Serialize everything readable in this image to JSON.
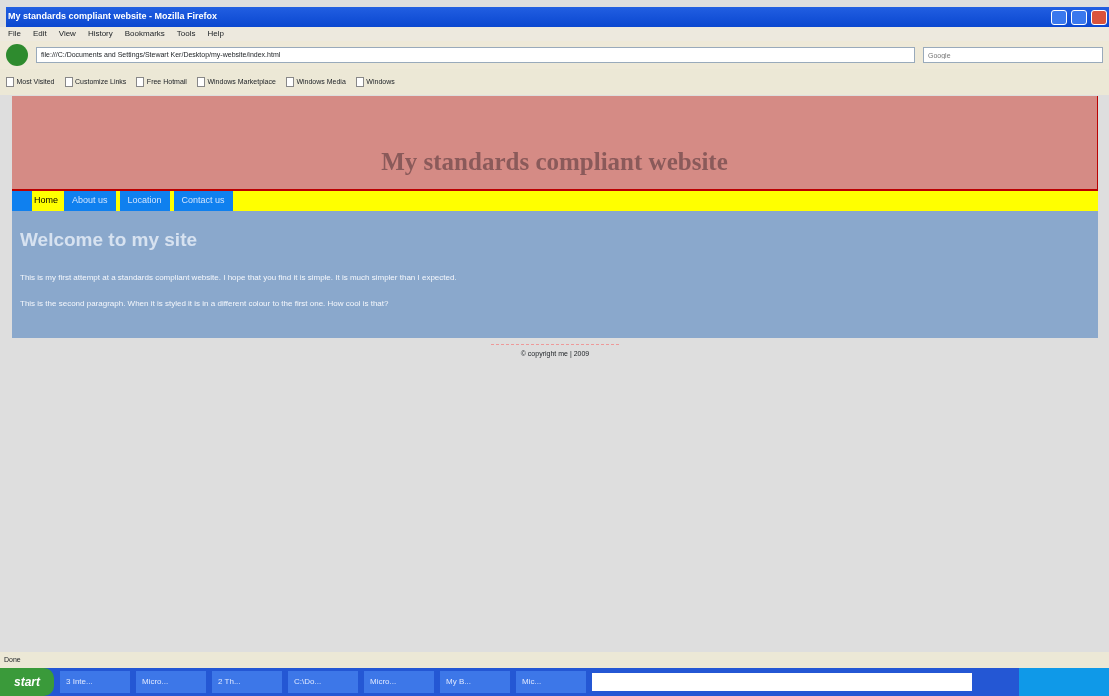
{
  "window": {
    "title": "My standards compliant website - Mozilla Firefox"
  },
  "menu": [
    "File",
    "Edit",
    "View",
    "History",
    "Bookmarks",
    "Tools",
    "Help"
  ],
  "address": {
    "value": "file:///C:/Documents and Settings/Stewart Ker/Desktop/my-website/index.html"
  },
  "search": {
    "placeholder": "Google"
  },
  "bookmarks": [
    "Most Visited",
    "Customize Links",
    "Free Hotmail",
    "Windows Marketplace",
    "Windows Media",
    "Windows"
  ],
  "site": {
    "heading": "My standards compliant website",
    "nav": [
      {
        "label": "Home",
        "selected": true
      },
      {
        "label": "About us",
        "selected": false
      },
      {
        "label": "Location",
        "selected": false
      },
      {
        "label": "Contact us",
        "selected": false
      }
    ],
    "title": "Welcome to my site",
    "paragraphs": [
      "This is my first attempt at a standards compliant website. I hope that you find it is simple. It is much simpler than I expected.",
      "This is the second paragraph. When it is styled it is in a different colour to the first one. How cool is that?"
    ],
    "footer": "© copyright me | 2009"
  },
  "status_bar": "Done",
  "taskbar": {
    "start": "start",
    "items": [
      "3 Inte...",
      "Micro...",
      "2 Th...",
      "C:\\Do...",
      "Micro...",
      "My B...",
      "Mic..."
    ]
  }
}
